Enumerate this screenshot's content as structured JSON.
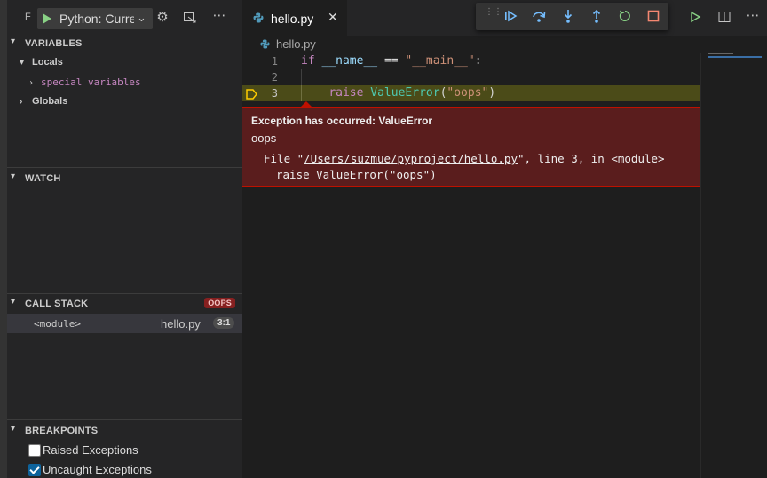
{
  "sidebar": {
    "truncated_prefix": "F",
    "launch_config": "Python: Current File",
    "sections": {
      "variables": {
        "title": "VARIABLES",
        "locals_label": "Locals",
        "special_variables": "special variables",
        "globals_label": "Globals"
      },
      "watch": {
        "title": "WATCH"
      },
      "call_stack": {
        "title": "CALL STACK",
        "badge": "OOPS",
        "frames": [
          {
            "function": "<module>",
            "file": "hello.py",
            "position": "3:1"
          }
        ]
      },
      "breakpoints": {
        "title": "BREAKPOINTS",
        "items": [
          {
            "label": "Raised Exceptions",
            "checked": false
          },
          {
            "label": "Uncaught Exceptions",
            "checked": true
          }
        ]
      }
    }
  },
  "editor": {
    "tab": {
      "label": "hello.py",
      "close": "✕"
    },
    "breadcrumb": "hello.py",
    "lines": [
      {
        "number": "1",
        "text": "if __name__ == \"__main__\":"
      },
      {
        "number": "2",
        "text": ""
      },
      {
        "number": "3",
        "text": "    raise ValueError(\"oops\")"
      }
    ],
    "exception": {
      "title": "Exception has occurred: ValueError",
      "message": "oops",
      "file_prefix": "File \"",
      "file_path": "/Users/suzmue/pyproject/hello.py",
      "file_suffix": "\", line 3, in <module>",
      "source_line": "raise ValueError(\"oops\")"
    }
  },
  "debug_toolbar": {
    "buttons": [
      "continue",
      "step-over",
      "step-into",
      "step-out",
      "restart",
      "stop"
    ]
  },
  "colors": {
    "accent_blue": "#75beff",
    "restart_green": "#89d185",
    "stop_red": "#f48771",
    "exception_bg": "#5a1d1d",
    "current_line": "#4b4b18"
  }
}
